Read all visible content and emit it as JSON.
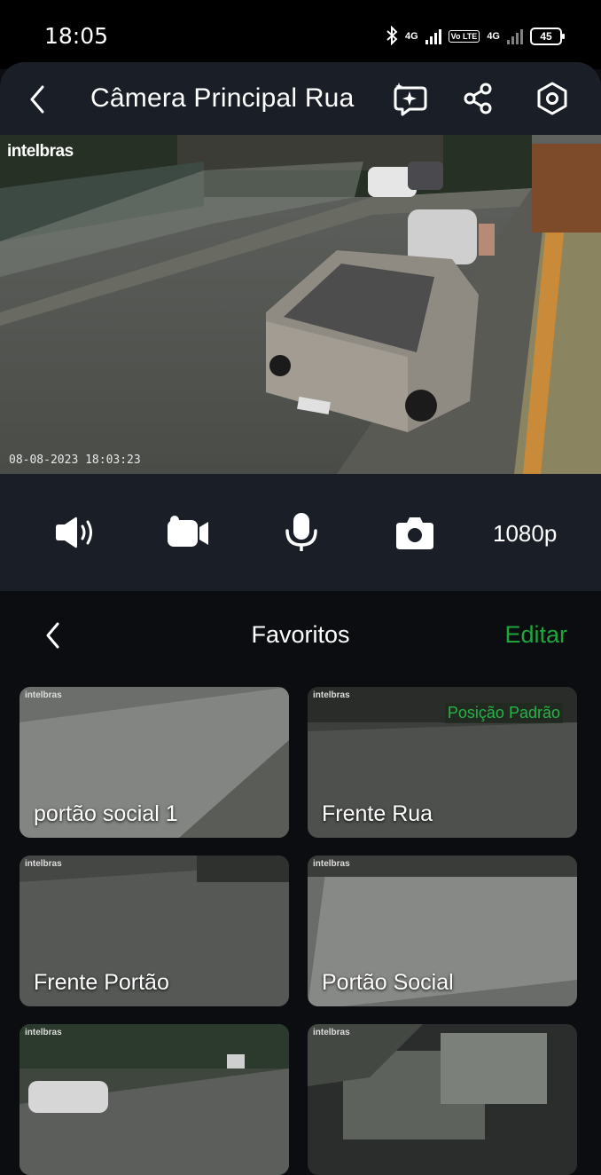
{
  "status_bar": {
    "time": "18:05",
    "network_1": "4G",
    "network_2": "4G",
    "volte": "Vo LTE",
    "battery": "45"
  },
  "header": {
    "title": "Câmera Principal Rua",
    "icons": [
      "back-chevron-icon",
      "ai-sparkle-icon",
      "share-icon",
      "settings-hexagon-icon"
    ]
  },
  "video": {
    "brand": "intelbras",
    "timestamp": "08-08-2023 18:03:23"
  },
  "controls": {
    "icons": [
      "speaker-icon",
      "video-record-icon",
      "microphone-icon",
      "camera-snapshot-icon"
    ],
    "quality": "1080p"
  },
  "favorites": {
    "title": "Favoritos",
    "edit": "Editar",
    "tiles": [
      {
        "label": "portão social 1",
        "brand": "intelbras",
        "badge": ""
      },
      {
        "label": "Frente Rua",
        "brand": "intelbras",
        "badge": "Posição Padrão"
      },
      {
        "label": "Frente Portão",
        "brand": "intelbras",
        "badge": ""
      },
      {
        "label": "Portão Social",
        "brand": "intelbras",
        "badge": ""
      },
      {
        "label": "",
        "brand": "intelbras",
        "badge": "",
        "selected": true
      },
      {
        "label": "",
        "brand": "intelbras",
        "badge": ""
      }
    ]
  },
  "colors": {
    "accent_green": "#1ea63c",
    "panel": "#1a1f27",
    "background": "#0b0d10"
  }
}
